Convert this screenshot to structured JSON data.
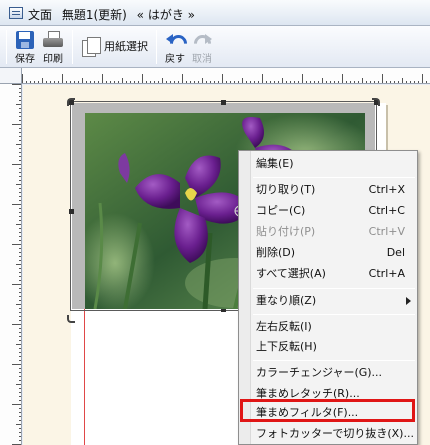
{
  "window": {
    "app_name": "文面",
    "doc_title": "無題1(更新)",
    "doc_type": "« はがき »"
  },
  "toolbar": {
    "save_label": "保存",
    "print_label": "印刷",
    "paper_select_label": "用紙選択",
    "undo_label": "戻す",
    "redo_label": "取消"
  },
  "context_menu": {
    "items": [
      {
        "label": "編集(E)",
        "shortcut": "",
        "disabled": false
      },
      {
        "label": "切り取り(T)",
        "shortcut": "Ctrl+X",
        "disabled": false
      },
      {
        "label": "コピー(C)",
        "shortcut": "Ctrl+C",
        "disabled": false
      },
      {
        "label": "貼り付け(P)",
        "shortcut": "Ctrl+V",
        "disabled": true
      },
      {
        "label": "削除(D)",
        "shortcut": "Del",
        "disabled": false
      },
      {
        "label": "すべて選択(A)",
        "shortcut": "Ctrl+A",
        "disabled": false
      },
      {
        "label": "重なり順(Z)",
        "shortcut": "",
        "disabled": false,
        "submenu": true
      },
      {
        "label": "左右反転(I)",
        "shortcut": "",
        "disabled": false
      },
      {
        "label": "上下反転(H)",
        "shortcut": "",
        "disabled": false
      },
      {
        "label": "カラーチェンジャー(G)...",
        "shortcut": "",
        "disabled": false
      },
      {
        "label": "筆まめレタッチ(R)...",
        "shortcut": "",
        "disabled": false
      },
      {
        "label": "筆まめフィルタ(F)...",
        "shortcut": "",
        "disabled": false,
        "highlighted": true
      },
      {
        "label": "フォトカッターで切り抜き(X)...",
        "shortcut": "",
        "disabled": false
      }
    ]
  },
  "colors": {
    "highlight_border": "#e01616",
    "canvas_bg": "#fbf5e6",
    "accent_blue": "#2a63c4"
  },
  "icons": [
    "app-icon",
    "save-icon",
    "print-icon",
    "paper-icon",
    "undo-icon",
    "redo-icon",
    "submenu-arrow-icon"
  ]
}
